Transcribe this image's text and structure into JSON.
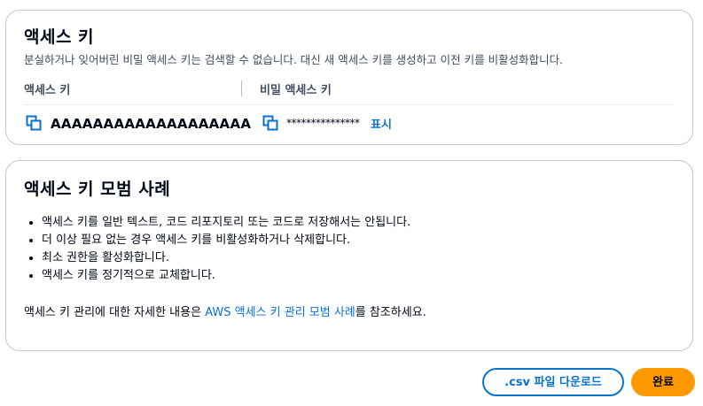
{
  "access_keys_card": {
    "title": "액세스 키",
    "description": "분실하거나 잊어버린 비밀 액세스 키는 검색할 수 없습니다. 대신 새 액세스 키를 생성하고 이전 키를 비활성화합니다.",
    "col_access_key": "액세스 키",
    "col_secret_key": "비밀 액세스 키",
    "access_key_value": "AAAAAAAAAAAAAAAAAAA",
    "secret_key_masked": "***************",
    "show_label": "표시"
  },
  "best_practices_card": {
    "title": "액세스 키 모범 사례",
    "items": [
      "액세스 키를 일반 텍스트, 코드 리포지토리 또는 코드로 저장해서는 안됩니다.",
      "더 이상 필요 없는 경우 액세스 키를 비활성화하거나 삭제합니다.",
      "최소 권한을 활성화합니다.",
      "액세스 키를 정기적으로 교체합니다."
    ],
    "more_info_prefix": "액세스 키 관리에 대한 자세한 내용은 ",
    "more_info_link": "AWS 액세스 키 관리 모범 사례",
    "more_info_suffix": "를 참조하세요."
  },
  "footer": {
    "download_label": ".csv 파일 다운로드",
    "done_label": "완료"
  },
  "colors": {
    "link": "#0972d3",
    "primary_button": "#ff9900",
    "text": "#000716",
    "secondary_text": "#414d5c",
    "border": "#c6c6cd"
  },
  "icons": {
    "copy": "copy-icon"
  }
}
